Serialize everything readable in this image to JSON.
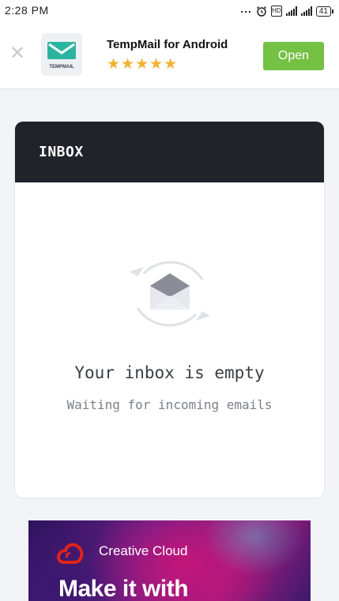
{
  "status_bar": {
    "time": "2:28 PM",
    "battery": "41"
  },
  "ad_banner": {
    "app_name": "TempMail for Android",
    "icon_label": "TEMPMAIL",
    "rating_stars": "★★★★★",
    "rating": 5,
    "open_label": "Open",
    "close_glyph": "✕",
    "colors": {
      "open_button": "#74c144",
      "stars": "#f2b230",
      "icon_accent": "#2bb5a0"
    }
  },
  "inbox": {
    "title": "INBOX",
    "empty_title": "Your inbox is empty",
    "empty_subtitle": "Waiting for incoming emails",
    "colors": {
      "header_bg": "#21232b"
    }
  },
  "bottom_ad": {
    "brand": "Creative Cloud",
    "headline": "Make it with",
    "colors": {
      "logo": "#e2231a"
    }
  }
}
